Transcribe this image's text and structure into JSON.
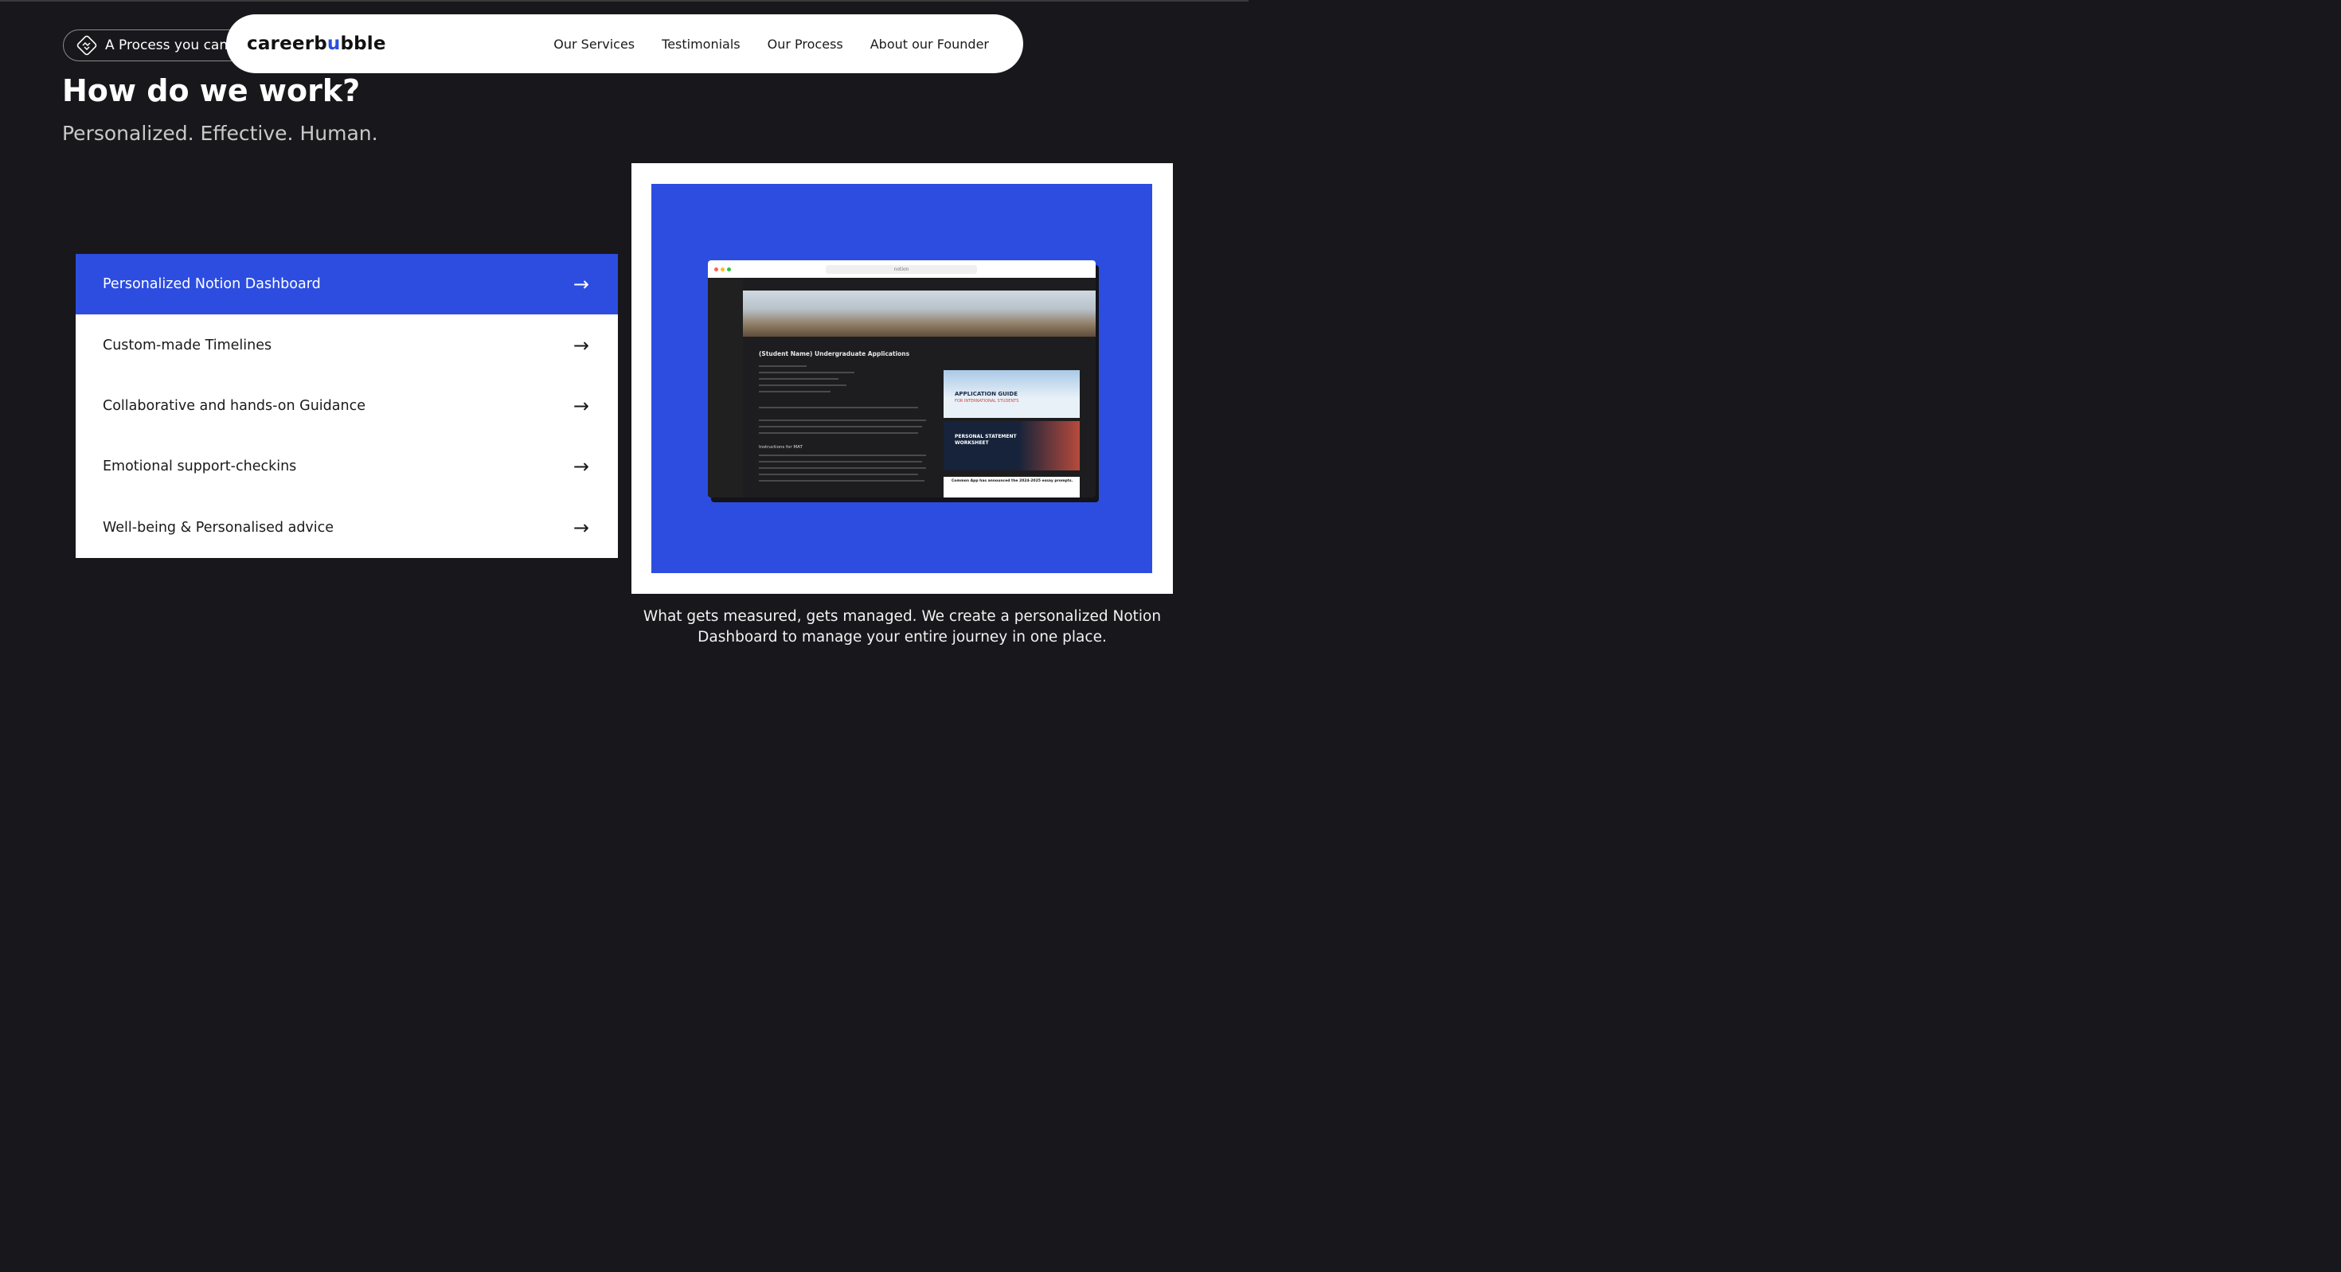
{
  "badge": {
    "text": "A Process you can",
    "icon": "handshake-icon"
  },
  "navbar": {
    "logo_left": "careerb",
    "logo_u": "u",
    "logo_right": "bble",
    "links": [
      "Our Services",
      "Testimonials",
      "Our Process",
      "About our Founder"
    ]
  },
  "hero": {
    "title": "How do we work?",
    "subtitle": "Personalized. Effective. Human."
  },
  "process_items": [
    {
      "label": "Personalized Notion Dashboard",
      "icon": "arrow-right-icon",
      "active": true
    },
    {
      "label": "Custom-made Timelines",
      "icon": "arrow-right-icon",
      "active": false
    },
    {
      "label": "Collaborative and hands-on Guidance",
      "icon": "arrow-right-icon",
      "active": false
    },
    {
      "label": "Emotional support-checkins",
      "icon": "arrow-right-icon",
      "active": false
    },
    {
      "label": "Well-being & Personalised advice",
      "icon": "arrow-right-icon",
      "active": false
    }
  ],
  "preview": {
    "url": "notion",
    "doc_title": "(Student Name) Undergraduate Applications",
    "section_heading": "Instructions for MAT",
    "thumb_application_guide": "APPLICATION GUIDE",
    "thumb_application_sub": "FOR INTERNATIONAL STUDENTS",
    "thumb_personal_statement": "PERSONAL STATEMENT",
    "thumb_worksheet": "WORKSHEET",
    "thumb_common_app": "Common App has announced the 2024-2025 essay prompts."
  },
  "caption": "What gets measured, gets managed. We create a personalized Notion Dashboard to manage your entire journey in one place.",
  "colors": {
    "accent": "#2d4de0",
    "background": "#18171b"
  }
}
